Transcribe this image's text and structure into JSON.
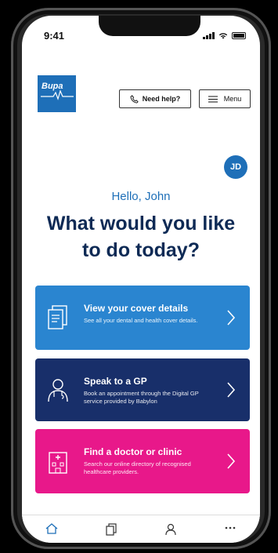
{
  "status_bar": {
    "time": "9:41"
  },
  "brand": {
    "logo_text": "Bupa",
    "color": "#1e6fb8"
  },
  "header": {
    "help_label": "Need help?",
    "menu_label": "Menu"
  },
  "user": {
    "initials": "JD"
  },
  "greeting": "Hello, John",
  "headline": "What would you like to do today?",
  "cards": [
    {
      "title": "View your cover details",
      "description": "See all your dental and health cover details.",
      "icon": "document-icon",
      "color": "#2a85d0"
    },
    {
      "title": "Speak to a GP",
      "description": "Book an appointment through the Digital GP service provided by Babylon",
      "icon": "doctor-icon",
      "color": "#182f6a"
    },
    {
      "title": "Find a doctor or clinic",
      "description": "Search our online directory of recognised healthcare providers.",
      "icon": "hospital-icon",
      "color": "#e8188a"
    }
  ],
  "tabbar": {
    "items": [
      "home-icon",
      "documents-icon",
      "profile-icon",
      "more-icon"
    ]
  }
}
